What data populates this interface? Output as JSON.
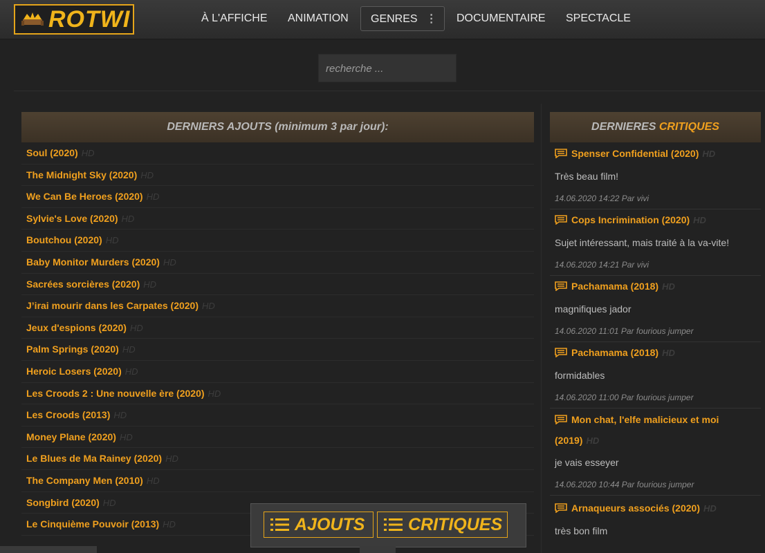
{
  "logo": {
    "text": "ROTWI"
  },
  "nav": [
    {
      "label": "À L'AFFICHE"
    },
    {
      "label": "ANIMATION"
    },
    {
      "label": "GENRES"
    },
    {
      "label": "DOCUMENTAIRE"
    },
    {
      "label": "SPECTACLE"
    }
  ],
  "search": {
    "placeholder": "recherche ..."
  },
  "left_panel": {
    "heading": "DERNIERS AJOUTS (minimum 3 par jour):",
    "items": [
      {
        "title": "Soul (2020)",
        "badge": "HD"
      },
      {
        "title": "The Midnight Sky (2020)",
        "badge": "HD"
      },
      {
        "title": "We Can Be Heroes (2020)",
        "badge": "HD"
      },
      {
        "title": "Sylvie's Love (2020)",
        "badge": "HD"
      },
      {
        "title": "Boutchou (2020)",
        "badge": "HD"
      },
      {
        "title": "Baby Monitor Murders (2020)",
        "badge": "HD"
      },
      {
        "title": "Sacrées sorcières (2020)",
        "badge": "HD"
      },
      {
        "title": "J’irai mourir dans les Carpates (2020)",
        "badge": "HD"
      },
      {
        "title": "Jeux d'espions (2020)",
        "badge": "HD"
      },
      {
        "title": "Palm Springs (2020)",
        "badge": "HD"
      },
      {
        "title": "Heroic Losers (2020)",
        "badge": "HD"
      },
      {
        "title": "Les Croods 2 : Une nouvelle ère (2020)",
        "badge": "HD"
      },
      {
        "title": "Les Croods (2013)",
        "badge": "HD"
      },
      {
        "title": "Money Plane (2020)",
        "badge": "HD"
      },
      {
        "title": "Le Blues de Ma Rainey (2020)",
        "badge": "HD"
      },
      {
        "title": "The Company Men (2010)",
        "badge": "HD"
      },
      {
        "title": "Songbird (2020)",
        "badge": "HD"
      },
      {
        "title": "Le Cinquième Pouvoir (2013)",
        "badge": "HD"
      }
    ]
  },
  "right_panel": {
    "heading_part1": "DERNIERES",
    "heading_part2": "CRITIQUES",
    "reviews": [
      {
        "title": "Spenser Confidential (2020)",
        "badge": "HD",
        "text": "Très beau film!",
        "meta": "14.06.2020 14:22 Par vivi"
      },
      {
        "title": "Cops Incrimination (2020)",
        "badge": "HD",
        "text": "Sujet intéressant, mais traité à la va-vite!",
        "meta": "14.06.2020 14:21 Par vivi"
      },
      {
        "title": "Pachamama (2018)",
        "badge": "HD",
        "text": "magnifiques jador",
        "meta": "14.06.2020 11:01 Par fourious jumper"
      },
      {
        "title": "Pachamama (2018)",
        "badge": "HD",
        "text": "formidables",
        "meta": "14.06.2020 11:00 Par fourious jumper"
      },
      {
        "title": "Mon chat, l'elfe malicieux et moi (2019)",
        "badge": "HD",
        "text": "je vais esseyer",
        "meta": "14.06.2020 10:44 Par fourious jumper"
      },
      {
        "title": "Arnaqueurs associés (2020)",
        "badge": "HD",
        "text": "très bon film",
        "meta": ""
      }
    ]
  },
  "floating_bar": {
    "ajouts_label": "AJOUTS",
    "critiques_label": "CRITIQUES"
  },
  "colors": {
    "accent": "#f0a01e",
    "background": "#222222",
    "badge": "#3d3d3d"
  }
}
